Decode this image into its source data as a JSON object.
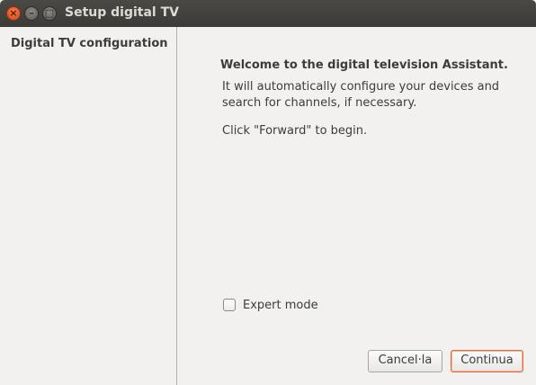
{
  "window": {
    "title": "Setup digital TV",
    "controls": {
      "close": "×",
      "minimize": "–",
      "maximize": "□"
    }
  },
  "sidebar": {
    "items": [
      {
        "label": "Digital TV configuration"
      }
    ]
  },
  "main": {
    "heading": "Welcome to the digital television Assistant.",
    "description": "It will automatically configure your devices and search for channels, if necessary.",
    "instruction": "Click \"Forward\" to begin.",
    "expert_mode": {
      "label": "Expert mode",
      "checked": false
    }
  },
  "buttons": {
    "cancel": "Cancel·la",
    "forward": "Continua"
  },
  "colors": {
    "titlebar": "#3c3b37",
    "close_button": "#e2571f",
    "default_button_border": "#e3683c",
    "background": "#f2f1f0"
  }
}
